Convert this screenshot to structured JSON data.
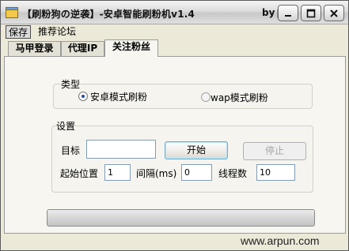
{
  "window": {
    "title": "【刷粉狗の逆袭】-安卓智能刷粉机v1.4",
    "title_by": "by",
    "title_suffix": "..."
  },
  "menubar": {
    "items": [
      "保存",
      "推荐论坛"
    ]
  },
  "tabs": [
    {
      "label": "马甲登录",
      "selected": false
    },
    {
      "label": "代理IP",
      "selected": false
    },
    {
      "label": "关注粉丝",
      "selected": true
    }
  ],
  "type_group": {
    "label": "类型",
    "options": [
      {
        "label": "安卓模式刷粉",
        "checked": true
      },
      {
        "label": "wap模式刷粉",
        "checked": false
      }
    ]
  },
  "settings_group": {
    "label": "设置",
    "target_label": "目标",
    "target_value": "",
    "start_button": "开始",
    "stop_button": "停止",
    "start_pos_label": "起始位置",
    "start_pos_value": "1",
    "interval_label": "间隔(ms)",
    "interval_value": "0",
    "threads_label": "线程数",
    "threads_value": "10"
  },
  "progress": {
    "value": 0
  },
  "watermark": "www.arpun.com",
  "colors": {
    "accent": "#1e4fa0",
    "window_bg": "#ece9d8",
    "panel_bg": "#f7f6f1"
  }
}
